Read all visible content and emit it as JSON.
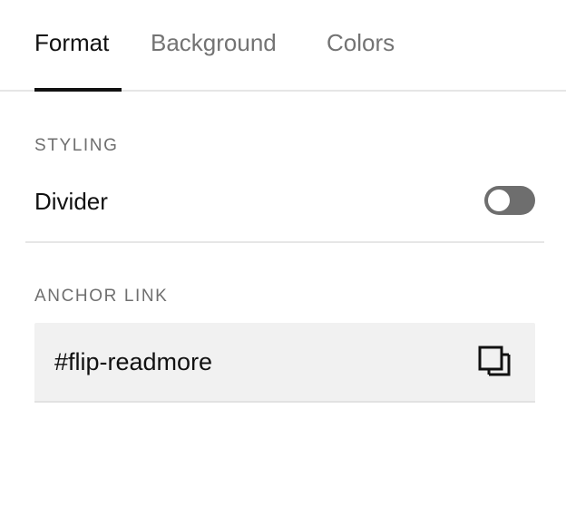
{
  "tabs": [
    {
      "label": "Format",
      "active": true
    },
    {
      "label": "Background",
      "active": false
    },
    {
      "label": "Colors",
      "active": false
    }
  ],
  "styling": {
    "section_label": "STYLING",
    "divider_label": "Divider",
    "divider_enabled": false
  },
  "anchor_link": {
    "section_label": "ANCHOR LINK",
    "value": "#flip-readmore",
    "copy_icon": "copy-icon"
  },
  "colors": {
    "active_text": "#111111",
    "inactive_tab": "#737373",
    "toggle_off": "#6e6e6e",
    "field_background": "#f1f1f1"
  }
}
